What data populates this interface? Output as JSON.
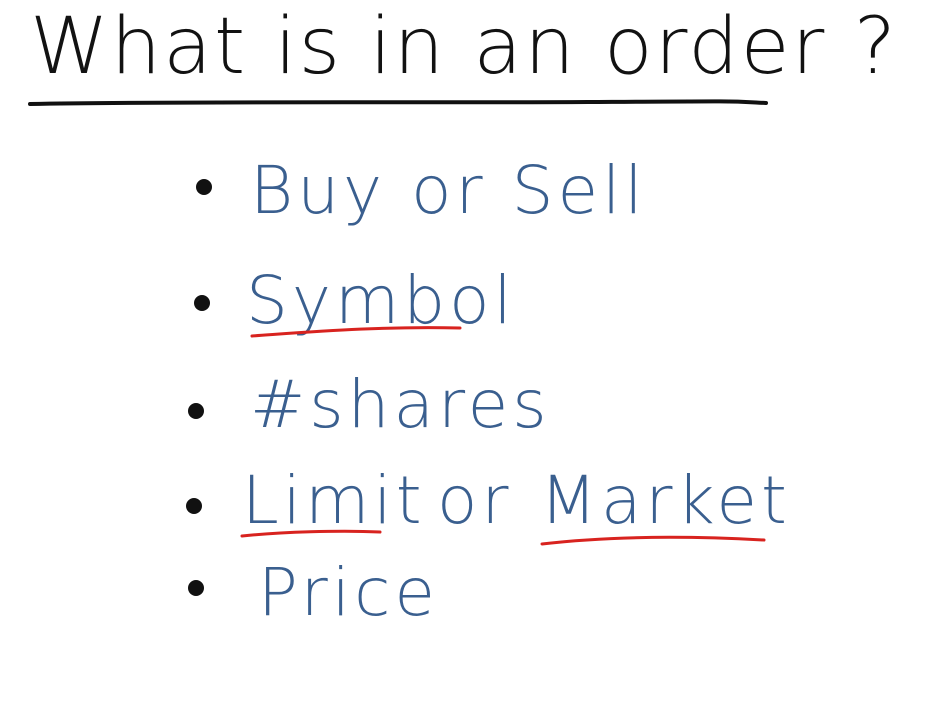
{
  "title": "What is in an order ?",
  "items": [
    {
      "label": "Buy or Sell"
    },
    {
      "label": "Symbol"
    },
    {
      "label": "#shares"
    },
    {
      "label": "Limit",
      "connector": "or",
      "label2": "Market"
    },
    {
      "label": "Price"
    }
  ],
  "colors": {
    "title": "#121212",
    "items": "#3a5f8f",
    "bullets": "#111111",
    "underline_title": "#111111",
    "underline_highlight": "#d8231f"
  }
}
